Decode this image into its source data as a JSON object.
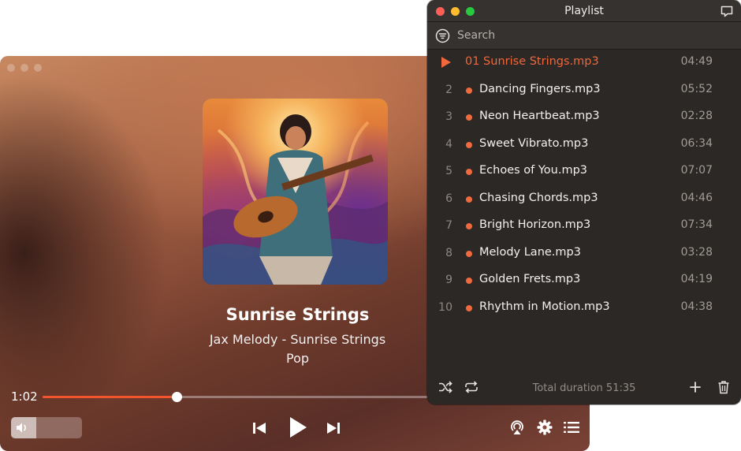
{
  "player": {
    "song_title": "Sunrise Strings",
    "artist_album": "Jax Melody - Sunrise Strings",
    "genre": "Pop",
    "elapsed": "1:02",
    "progress_fraction": 0.34,
    "volume_fraction": 0.36,
    "accent_color": "#f2542d"
  },
  "playlist": {
    "title": "Playlist",
    "search_placeholder": "Search",
    "active_color": "#f0683c",
    "tracks": [
      {
        "num": "",
        "name": "01 Sunrise Strings.mp3",
        "duration": "04:49"
      },
      {
        "num": "2",
        "name": "Dancing Fingers.mp3",
        "duration": "05:52"
      },
      {
        "num": "3",
        "name": "Neon Heartbeat.mp3",
        "duration": "02:28"
      },
      {
        "num": "4",
        "name": "Sweet Vibrato.mp3",
        "duration": "06:34"
      },
      {
        "num": "5",
        "name": "Echoes of You.mp3",
        "duration": "07:07"
      },
      {
        "num": "6",
        "name": "Chasing Chords.mp3",
        "duration": "04:46"
      },
      {
        "num": "7",
        "name": "Bright Horizon.mp3",
        "duration": "07:34"
      },
      {
        "num": "8",
        "name": "Melody Lane.mp3",
        "duration": "03:28"
      },
      {
        "num": "9",
        "name": "Golden Frets.mp3",
        "duration": "04:19"
      },
      {
        "num": "10",
        "name": "Rhythm in Motion.mp3",
        "duration": "04:38"
      }
    ],
    "total_duration": "Total duration 51:35"
  },
  "icons": [
    "close-icon",
    "minimize-icon",
    "zoom-icon",
    "chat-icon",
    "filter-icon",
    "play-icon",
    "shuffle-icon",
    "repeat-icon",
    "add-icon",
    "trash-icon",
    "volume-icon",
    "previous-icon",
    "next-icon",
    "airplay-icon",
    "gear-icon",
    "list-icon"
  ]
}
